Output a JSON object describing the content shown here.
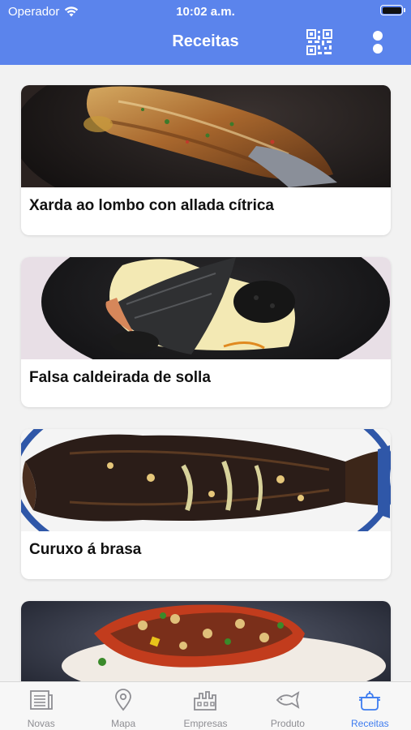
{
  "status_bar": {
    "carrier": "Operador",
    "time": "10:02 a.m."
  },
  "header": {
    "title": "Receitas",
    "qr_icon": "qr-code-icon",
    "more_icon": "more-vertical-icon"
  },
  "recipes": [
    {
      "title": "Xarda ao lombo con allada cítrica"
    },
    {
      "title": "Falsa caldeirada de solla"
    },
    {
      "title": "Curuxo á brasa"
    },
    {
      "title": ""
    }
  ],
  "tabbar": {
    "active_color": "#3e7cf0",
    "items": [
      {
        "label": "Novas",
        "icon": "newspaper-icon"
      },
      {
        "label": "Mapa",
        "icon": "map-pin-icon"
      },
      {
        "label": "Empresas",
        "icon": "factory-icon"
      },
      {
        "label": "Produto",
        "icon": "fish-icon"
      },
      {
        "label": "Receitas",
        "icon": "pot-icon"
      }
    ]
  }
}
